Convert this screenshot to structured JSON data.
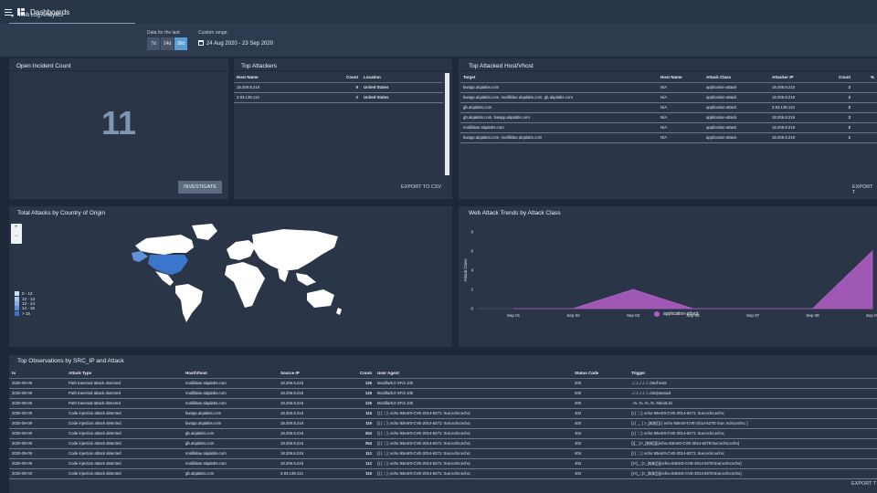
{
  "header": {
    "title": "Dashboards",
    "menu_icon": "menu-icon",
    "dashboard_icon": "dashboard-icon"
  },
  "filters": {
    "app": "Web Log Analytics",
    "data_label": "Data for the last:",
    "periods": [
      {
        "label": "7d",
        "active": false
      },
      {
        "label": "14d",
        "active": false
      },
      {
        "label": "30d",
        "active": true
      }
    ],
    "custom_label": "Custom range:",
    "range": "24 Aug 2020 - 23 Sep 2020"
  },
  "incidents": {
    "title": "Open Incident Count",
    "count": "11",
    "button": "INVESTIGATE"
  },
  "attackers": {
    "title": "Top Attackers",
    "columns": [
      "Host Name",
      "Count",
      "Location"
    ],
    "rows": [
      [
        "18.206.8.216",
        "9",
        "United States"
      ],
      [
        "3.93.138.114",
        "2",
        "United States"
      ]
    ],
    "export": "EXPORT TO CSV"
  },
  "hosts": {
    "title": "Top Attacked Host/Vhost",
    "columns": [
      "Target",
      "Host Name",
      "Attack Class",
      "Attacker IP",
      "Count",
      "%"
    ],
    "rows": [
      [
        "bwapp.alqalabs.com",
        "N/A",
        "application-attack",
        "18.206.8.216",
        "2",
        ""
      ],
      [
        "bwapp.alqalabs.com, mutillidae.alqalabs.com, gb.alqalabs.com",
        "N/A",
        "application-attack",
        "18.206.8.216",
        "2",
        ""
      ],
      [
        "gb.alqalabs.com",
        "N/A",
        "application-attack",
        "3.93.138.114",
        "2",
        ""
      ],
      [
        "gb.alqalabs.com, bwapp.alqalabs.com",
        "N/A",
        "application-attack",
        "18.206.8.216",
        "2",
        ""
      ],
      [
        "mutillidae.alqalabs.com",
        "N/A",
        "application-attack",
        "18.206.8.216",
        "2",
        ""
      ],
      [
        "bwapp.alqalabs.com, mutillidae.alqalabs.com",
        "N/A",
        "application-attack",
        "18.206.8.216",
        "1",
        ""
      ]
    ],
    "export": "EXPORT T"
  },
  "map": {
    "title": "Total Attacks by Country of Origin",
    "zoom_in": "+",
    "zoom_out": "−",
    "legend": [
      {
        "label": "0 - 12",
        "color": "#cfe0f5"
      },
      {
        "label": "12 - 13",
        "color": "#a9c6ec"
      },
      {
        "label": "13 - 14",
        "color": "#86aee2"
      },
      {
        "label": "14 - 15",
        "color": "#5e92d8"
      },
      {
        "label": "> 15",
        "color": "#3c76cc"
      }
    ]
  },
  "trends": {
    "title": "Web Attack Trends by Attack Class",
    "chart_data": {
      "type": "area",
      "ylabel": "Attack Class",
      "x": [
        "Sep 01",
        "Sep 02",
        "Sep 03",
        "Sep 06",
        "Sep 07",
        "Sep 08",
        "Sep 09"
      ],
      "yticks": [
        "0",
        "2",
        "4",
        "6",
        "8"
      ],
      "ylim": [
        0,
        8
      ],
      "series": [
        {
          "name": "application-attack",
          "color": "#b45fc8",
          "values": [
            0,
            0,
            2,
            0,
            0,
            0,
            6
          ]
        }
      ]
    }
  },
  "observations": {
    "title": "Top Observations by SRC_IP and Attack",
    "columns": [
      "ts",
      "Attack Type",
      "Host/Vhost",
      "Source IP",
      "Count",
      "User Agent",
      "Status Code",
      "Trigger"
    ],
    "rows": [
      [
        "2020-09-09",
        "Path traversal attack detected",
        "mutillidae.alqalabs.com",
        "18.206.8.216",
        "126",
        "Mozilla/5.0 SF/2.10b",
        "200",
        "../../../../../../etc/hosts"
      ],
      [
        "2020-09-09",
        "Path traversal attack detected",
        "mutillidae.alqalabs.com",
        "18.206.8.216",
        "126",
        "Mozilla/5.0 SF/2.10b",
        "200",
        "../../../../../../etc/passwd"
      ],
      [
        "2020-09-09",
        "Path traversal attack detected",
        "mutillidae.alqalabs.com",
        "18.206.8.216",
        "126",
        "Mozilla/5.0 SF/2.10b",
        "200",
        "..%..%..%..%..%boot.ini"
      ],
      [
        "2020-09-09",
        "Code injection attack detected",
        "bwapp.alqalabs.com",
        "18.206.8.216",
        "115",
        "() { :; }; echo 93e4r0-CVE-2014-6271: true;echo;echo;",
        "404",
        "() { :; }; echo 93e4r0-CVE-2014-6271: true;echo;echo;"
      ],
      [
        "2020-09-09",
        "Code injection attack detected",
        "bwapp.alqalabs.com",
        "18.206.8.216",
        "115",
        "() { :; }; echo 93e4r0-CVE-2014-6271: true;echo;echo;",
        "404",
        "() { _; } >_[$($())] { echo 93e4r0-CVE-2014-6278: true; echo;echo; }"
      ],
      [
        "2020-09-09",
        "Code injection attack detected",
        "gb.alqalabs.com",
        "18.206.8.216",
        "254",
        "() { :; }; echo 93e4r0-CVE-2014-6271: true;echo;echo;",
        "404",
        "() { :; }; echo 93e4r0-CVE-2014-6271: true;echo;echo;"
      ],
      [
        "2020-09-09",
        "Code injection attack detected",
        "gb.alqalabs.com",
        "18.206.8.216",
        "254",
        "() { :; }; echo 93e4r0-CVE-2014-6271: true;echo;echo;",
        "404",
        "(){_:;}>_[$($())]{echo=93e4r0-CVE-2014-6278:true;echo;echo}"
      ],
      [
        "2020-09-09",
        "Code injection attack detected",
        "mutillidae.alqalabs.com",
        "18.206.8.216",
        "112",
        "() { :; }; echo 93e4r0-CVE-2014-6271: true;echo;echo;",
        "404",
        "() { :; }; echo 93e4r0-CVE-2014-6271: true;echo;echo;"
      ],
      [
        "2020-09-09",
        "Code injection attack detected",
        "mutillidae.alqalabs.com",
        "18.206.8.216",
        "112",
        "() { :; }; echo 93e4r0-CVE-2014-6271: true;echo;echo;",
        "404",
        "()<{_:;}>_[$($())]{echo=93e4r0-CVE-2014-6278:true;echo;echo}"
      ],
      [
        "2020-09-03",
        "Code injection attack detected",
        "gb.alqalabs.com",
        "3.93.138.114",
        "116",
        "() { :; }; echo 93e4r0-CVE-2014-6271: true;echo;echo;",
        "404",
        "()<{_:;}>_[$($())]{echo=93e4r0-CVE-2014-6278:true;echo;echo}"
      ]
    ],
    "export": "EXPORT T"
  }
}
